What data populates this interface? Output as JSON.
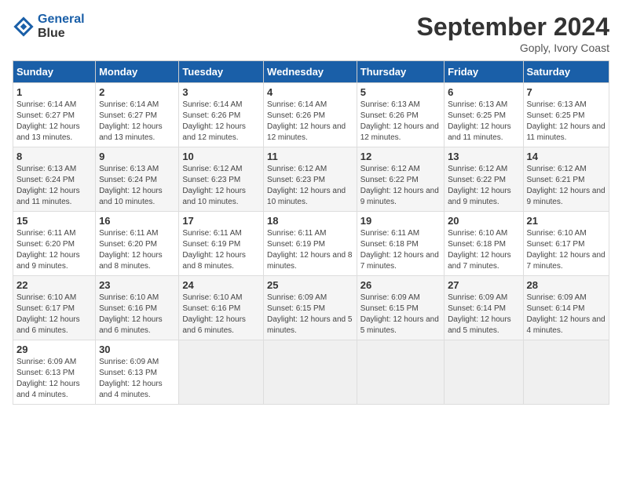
{
  "logo": {
    "line1": "General",
    "line2": "Blue"
  },
  "title": "September 2024",
  "subtitle": "Goply, Ivory Coast",
  "days_of_week": [
    "Sunday",
    "Monday",
    "Tuesday",
    "Wednesday",
    "Thursday",
    "Friday",
    "Saturday"
  ],
  "weeks": [
    [
      {
        "day": "1",
        "sunrise": "6:14 AM",
        "sunset": "6:27 PM",
        "daylight": "12 hours and 13 minutes."
      },
      {
        "day": "2",
        "sunrise": "6:14 AM",
        "sunset": "6:27 PM",
        "daylight": "12 hours and 13 minutes."
      },
      {
        "day": "3",
        "sunrise": "6:14 AM",
        "sunset": "6:26 PM",
        "daylight": "12 hours and 12 minutes."
      },
      {
        "day": "4",
        "sunrise": "6:14 AM",
        "sunset": "6:26 PM",
        "daylight": "12 hours and 12 minutes."
      },
      {
        "day": "5",
        "sunrise": "6:13 AM",
        "sunset": "6:26 PM",
        "daylight": "12 hours and 12 minutes."
      },
      {
        "day": "6",
        "sunrise": "6:13 AM",
        "sunset": "6:25 PM",
        "daylight": "12 hours and 11 minutes."
      },
      {
        "day": "7",
        "sunrise": "6:13 AM",
        "sunset": "6:25 PM",
        "daylight": "12 hours and 11 minutes."
      }
    ],
    [
      {
        "day": "8",
        "sunrise": "6:13 AM",
        "sunset": "6:24 PM",
        "daylight": "12 hours and 11 minutes."
      },
      {
        "day": "9",
        "sunrise": "6:13 AM",
        "sunset": "6:24 PM",
        "daylight": "12 hours and 10 minutes."
      },
      {
        "day": "10",
        "sunrise": "6:12 AM",
        "sunset": "6:23 PM",
        "daylight": "12 hours and 10 minutes."
      },
      {
        "day": "11",
        "sunrise": "6:12 AM",
        "sunset": "6:23 PM",
        "daylight": "12 hours and 10 minutes."
      },
      {
        "day": "12",
        "sunrise": "6:12 AM",
        "sunset": "6:22 PM",
        "daylight": "12 hours and 9 minutes."
      },
      {
        "day": "13",
        "sunrise": "6:12 AM",
        "sunset": "6:22 PM",
        "daylight": "12 hours and 9 minutes."
      },
      {
        "day": "14",
        "sunrise": "6:12 AM",
        "sunset": "6:21 PM",
        "daylight": "12 hours and 9 minutes."
      }
    ],
    [
      {
        "day": "15",
        "sunrise": "6:11 AM",
        "sunset": "6:20 PM",
        "daylight": "12 hours and 9 minutes."
      },
      {
        "day": "16",
        "sunrise": "6:11 AM",
        "sunset": "6:20 PM",
        "daylight": "12 hours and 8 minutes."
      },
      {
        "day": "17",
        "sunrise": "6:11 AM",
        "sunset": "6:19 PM",
        "daylight": "12 hours and 8 minutes."
      },
      {
        "day": "18",
        "sunrise": "6:11 AM",
        "sunset": "6:19 PM",
        "daylight": "12 hours and 8 minutes."
      },
      {
        "day": "19",
        "sunrise": "6:11 AM",
        "sunset": "6:18 PM",
        "daylight": "12 hours and 7 minutes."
      },
      {
        "day": "20",
        "sunrise": "6:10 AM",
        "sunset": "6:18 PM",
        "daylight": "12 hours and 7 minutes."
      },
      {
        "day": "21",
        "sunrise": "6:10 AM",
        "sunset": "6:17 PM",
        "daylight": "12 hours and 7 minutes."
      }
    ],
    [
      {
        "day": "22",
        "sunrise": "6:10 AM",
        "sunset": "6:17 PM",
        "daylight": "12 hours and 6 minutes."
      },
      {
        "day": "23",
        "sunrise": "6:10 AM",
        "sunset": "6:16 PM",
        "daylight": "12 hours and 6 minutes."
      },
      {
        "day": "24",
        "sunrise": "6:10 AM",
        "sunset": "6:16 PM",
        "daylight": "12 hours and 6 minutes."
      },
      {
        "day": "25",
        "sunrise": "6:09 AM",
        "sunset": "6:15 PM",
        "daylight": "12 hours and 5 minutes."
      },
      {
        "day": "26",
        "sunrise": "6:09 AM",
        "sunset": "6:15 PM",
        "daylight": "12 hours and 5 minutes."
      },
      {
        "day": "27",
        "sunrise": "6:09 AM",
        "sunset": "6:14 PM",
        "daylight": "12 hours and 5 minutes."
      },
      {
        "day": "28",
        "sunrise": "6:09 AM",
        "sunset": "6:14 PM",
        "daylight": "12 hours and 4 minutes."
      }
    ],
    [
      {
        "day": "29",
        "sunrise": "6:09 AM",
        "sunset": "6:13 PM",
        "daylight": "12 hours and 4 minutes."
      },
      {
        "day": "30",
        "sunrise": "6:09 AM",
        "sunset": "6:13 PM",
        "daylight": "12 hours and 4 minutes."
      },
      null,
      null,
      null,
      null,
      null
    ]
  ]
}
